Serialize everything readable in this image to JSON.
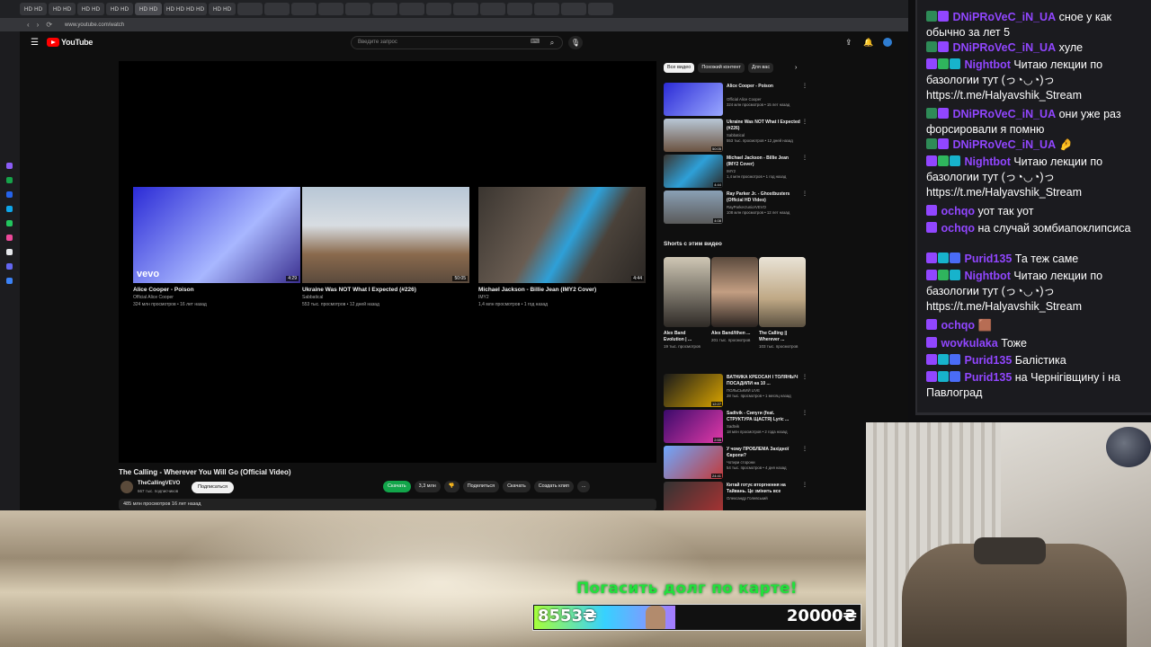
{
  "browser": {
    "url": "www.youtube.com/watch",
    "tab_labels": [
      "HD HD",
      "HD HD",
      "HD HD",
      "HD HD",
      "HD HD",
      "HD HD HD HD",
      "HD HD"
    ]
  },
  "youtube": {
    "logo_text": "YouTube",
    "search_placeholder": "Введите запрос",
    "endcards": [
      {
        "title": "Alice Cooper - Poison",
        "channel": "Official Alice Cooper",
        "meta": "324 млн просмотров • 16 лет назад",
        "duration": "4:29",
        "brand": "vevo"
      },
      {
        "title": "Ukraine Was NOT What I Expected (#226)",
        "channel": "Sabbatical",
        "meta": "553 тыс. просмотров • 12 дней назад",
        "duration": "50:05"
      },
      {
        "title": "Michael Jackson - Billie Jean (IMY2 Cover)",
        "channel": "IMY2",
        "meta": "1,4 млн просмотров • 1 год назад",
        "duration": "4:44"
      }
    ],
    "video_title": "The Calling - Wherever You Will Go (Official Video)",
    "channel_name": "TheCallingVEVO",
    "channel_subs": "667 тыс. подписчиков",
    "subscribe_label": "Подписаться",
    "actions": {
      "download_green": "Скачать",
      "likes": "3,3 млн",
      "share": "Поделиться",
      "download": "Скачать",
      "clip": "Создать клип",
      "more": "..."
    },
    "description_meta": "485 млн просмотров  16 лет назад",
    "chips": [
      "Все видео",
      "Похожий контент",
      "Для вас"
    ],
    "recs": [
      {
        "title": "Alice Cooper - Poison",
        "channel": "Official Alice Cooper",
        "meta": "324 млн просмотров • 15 лет назад",
        "duration": ""
      },
      {
        "title": "Ukraine Was NOT What I Expected (#226)",
        "channel": "Sabbatical",
        "meta": "553 тыс. просмотров • 12 дней назад",
        "duration": "50:05"
      },
      {
        "title": "Michael Jackson - Billie Jean (IMY2 Cover)",
        "channel": "IMY2",
        "meta": "1,4 млн просмотров • 1 год назад",
        "duration": "4:44"
      },
      {
        "title": "Ray Parker Jr. - Ghostbusters (Official HD Video)",
        "channel": "RayParkerJuniorVEVO",
        "meta": "108 млн просмотров • 12 лет назад",
        "duration": "4:08"
      },
      {
        "title": "ВАТНИКА КРЕОСАН І ТОЛЯНЫЧ ПОСАДИЛИ на 10 ...",
        "channel": "ПОЛЬСЬКИЙ LIVE",
        "meta": "28 тыс. просмотров • 1 месяц назад",
        "duration": "12:27"
      },
      {
        "title": "Sadtvik - Сипуги (feat. СТРУКТУРА ЩАСТЯ) Lyric ...",
        "channel": "Sadtvik",
        "meta": "18 млн просмотров • 2 года назад",
        "duration": "2:55"
      },
      {
        "title": "У чому ПРОБЛЕМА Західної Європи?",
        "channel": "Чотири сторони",
        "meta": "54 тыс. просмотров • 4 дня назад",
        "duration": "24:41"
      },
      {
        "title": "Китай готує вторгнення на Тайвань. Це змінить все",
        "channel": "Олександр Голевський",
        "meta": "",
        "duration": ""
      }
    ],
    "shorts_heading": "Shorts с этим видео",
    "shorts": [
      {
        "title": "Alex Band Evolution | ...",
        "views": "19 тыс. просмотров"
      },
      {
        "title": "Alex Band//then ...",
        "views": "201 тыс. просмотров"
      },
      {
        "title": "The Calling || Wherever ...",
        "views": "103 тыс. просмотров"
      }
    ]
  },
  "stream": {
    "alert_text": "Погасить долг по карте!",
    "goal_current": "8553₴",
    "goal_target": "20000₴",
    "goal_progress": 0.43
  },
  "chat": [
    {
      "user": "DNiPRoVeC_iN_UA",
      "color": "#9146ff",
      "text": "сное у как обычно за лет 5",
      "badges": [
        "#2e8b57",
        "#9146ff"
      ]
    },
    {
      "user": "DNiPRoVeC_iN_UA",
      "color": "#9146ff",
      "text": "хуле",
      "badges": [
        "#2e8b57",
        "#9146ff"
      ]
    },
    {
      "user": "Nightbot",
      "color": "#9146ff",
      "text": "Читаю лекции по базологии тут (っ◔◡◔)っ https://t.me/Halyavshik_Stream",
      "badges": [
        "#9146ff",
        "#2fb55d",
        "#17b3cc"
      ]
    },
    {
      "user": "DNiPRoVeC_iN_UA",
      "color": "#9146ff",
      "text": "они уже раз форсировали я помню",
      "badges": [
        "#2e8b57",
        "#9146ff"
      ]
    },
    {
      "user": "DNiPRoVeC_iN_UA",
      "color": "#9146ff",
      "text": "🤌",
      "badges": [
        "#2e8b57",
        "#9146ff"
      ]
    },
    {
      "user": "Nightbot",
      "color": "#9146ff",
      "text": "Читаю лекции по базологии тут (っ◔◡◔)っ https://t.me/Halyavshik_Stream",
      "badges": [
        "#9146ff",
        "#2fb55d",
        "#17b3cc"
      ]
    },
    {
      "user": "ochqo",
      "color": "#9146ff",
      "text": "уот так уот",
      "badges": [
        "#9146ff"
      ]
    },
    {
      "user": "ochqo",
      "color": "#9146ff",
      "text": "на случай зомбиапоклипсиса",
      "badges": [
        "#9146ff"
      ]
    },
    {
      "user": "Purid135",
      "color": "#9146ff",
      "text": "Та теж саме",
      "badges": [
        "#9146ff",
        "#17b3cc",
        "#4a6cf7"
      ]
    },
    {
      "user": "Nightbot",
      "color": "#9146ff",
      "text": "Читаю лекции по базологии тут (っ◔◡◔)っ https://t.me/Halyavshik_Stream",
      "badges": [
        "#9146ff",
        "#2fb55d",
        "#17b3cc"
      ]
    },
    {
      "user": "ochqo",
      "color": "#9146ff",
      "text": "🟫",
      "badges": [
        "#9146ff"
      ]
    },
    {
      "user": "wovkulaka",
      "color": "#9146ff",
      "text": "Тоже",
      "badges": [
        "#9146ff"
      ]
    },
    {
      "user": "Purid135",
      "color": "#9146ff",
      "text": "Балістика",
      "badges": [
        "#9146ff",
        "#17b3cc",
        "#4a6cf7"
      ]
    },
    {
      "user": "Purid135",
      "color": "#9146ff",
      "text": "на Чернігівщину і на Павлоград",
      "badges": [
        "#9146ff",
        "#17b3cc",
        "#4a6cf7"
      ]
    }
  ]
}
